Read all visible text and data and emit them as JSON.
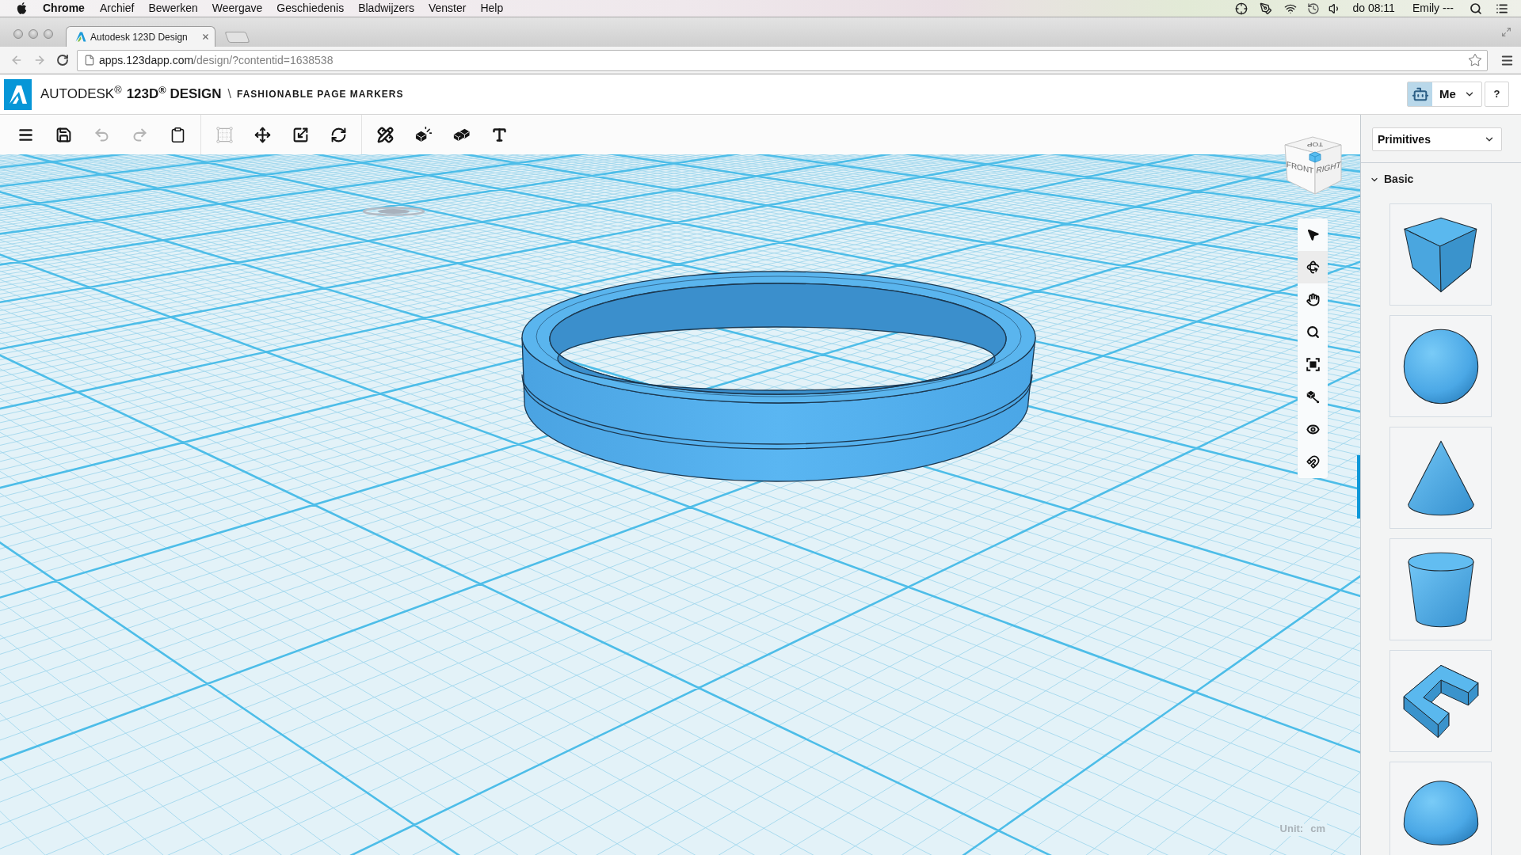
{
  "menu_bar": {
    "app": "Chrome",
    "menus": [
      "Archief",
      "Bewerken",
      "Weergave",
      "Geschiedenis",
      "Bladwijzers",
      "Venster",
      "Help"
    ],
    "clock": "do 08:11",
    "user": "Emily ---"
  },
  "browser": {
    "tab": {
      "title": "Autodesk 123D Design"
    },
    "nav": [
      {
        "kind": "back",
        "disabled": true
      },
      {
        "kind": "forward",
        "disabled": true
      },
      {
        "kind": "reload",
        "disabled": false
      }
    ],
    "url": {
      "host": "apps.123dapp.com",
      "path": "/design/?contentid=1638538"
    }
  },
  "header": {
    "brand": "AUTODESK$^{®}$",
    "product": "123D$^{®}$ DESIGN",
    "separator": "\\",
    "project": "FASHIONABLE PAGE MARKERS",
    "account": "Me",
    "help": "?"
  },
  "toolbar": [
    {
      "tools": [
        {
          "kind": "menu",
          "disabled": false
        },
        {
          "kind": "save",
          "disabled": false
        },
        {
          "kind": "undo",
          "disabled": true
        },
        {
          "kind": "redo",
          "disabled": true
        },
        {
          "kind": "clipboard",
          "disabled": false
        }
      ]
    },
    {
      "tools": [
        {
          "kind": "select_box",
          "disabled": true
        },
        {
          "kind": "move",
          "disabled": false
        },
        {
          "kind": "scale",
          "disabled": false
        },
        {
          "kind": "rotate",
          "disabled": false
        }
      ]
    },
    {
      "tools": [
        {
          "kind": "modify",
          "disabled": false
        },
        {
          "kind": "construct",
          "disabled": false
        },
        {
          "kind": "combine",
          "disabled": false
        },
        {
          "kind": "text",
          "disabled": false
        }
      ]
    }
  ],
  "viewport": {
    "view_cube": {
      "top": "TOP",
      "front": "FRONT",
      "right": "RIGHT"
    },
    "nav_tools": [
      {
        "kind": "select",
        "selected": false
      },
      {
        "kind": "orbit",
        "selected": true
      },
      {
        "kind": "pan",
        "selected": false
      },
      {
        "kind": "zoom",
        "selected": false
      },
      {
        "kind": "fit",
        "selected": false
      },
      {
        "kind": "zoom_selected",
        "selected": false
      },
      {
        "kind": "visibility",
        "selected": false
      },
      {
        "kind": "snap",
        "selected": false
      }
    ],
    "unit": {
      "label": "Unit:",
      "value": "cm"
    }
  },
  "panel": {
    "library": "Primitives",
    "sections": [
      {
        "title": "Basic",
        "expanded": true,
        "items": [
          {
            "kind": "box"
          },
          {
            "kind": "sphere"
          },
          {
            "kind": "cone"
          },
          {
            "kind": "cylinder"
          },
          {
            "kind": "wedge"
          },
          {
            "kind": "hemisphere"
          }
        ]
      }
    ]
  }
}
